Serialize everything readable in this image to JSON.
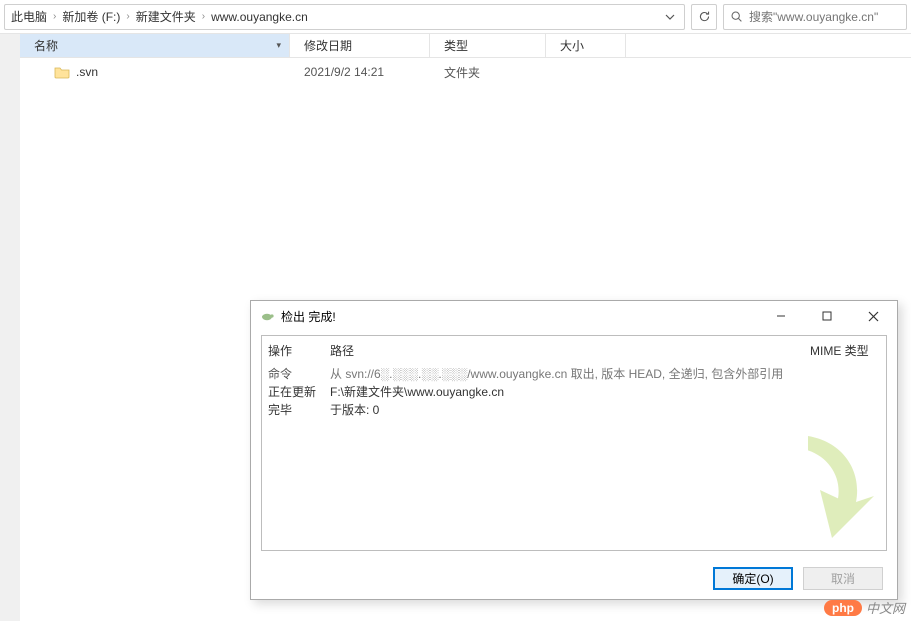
{
  "breadcrumbs": [
    "此电脑",
    "新加卷 (F:)",
    "新建文件夹",
    "www.ouyangke.cn"
  ],
  "search": {
    "placeholder": "搜索\"www.ouyangke.cn\""
  },
  "columns": {
    "name": "名称",
    "date": "修改日期",
    "type": "类型",
    "size": "大小"
  },
  "rows": [
    {
      "name": ".svn",
      "date": "2021/9/2 14:21",
      "type": "文件夹",
      "size": ""
    }
  ],
  "dialog": {
    "title": "检出 完成!",
    "headers": {
      "op": "操作",
      "path": "路径",
      "mime": "MIME 类型"
    },
    "lines": [
      {
        "op": "命令",
        "path": "从 svn://6░.░░░.░░.░░░/www.ouyangke.cn 取出, 版本 HEAD, 全递归, 包含外部引用",
        "dark": false
      },
      {
        "op": "正在更新",
        "path": "F:\\新建文件夹\\www.ouyangke.cn",
        "dark": true
      },
      {
        "op": "完毕",
        "path": "于版本: 0",
        "dark": true
      }
    ],
    "buttons": {
      "ok": "确定(O)",
      "cancel": "取消"
    }
  },
  "watermark": {
    "badge": "php",
    "text": "中文网"
  }
}
